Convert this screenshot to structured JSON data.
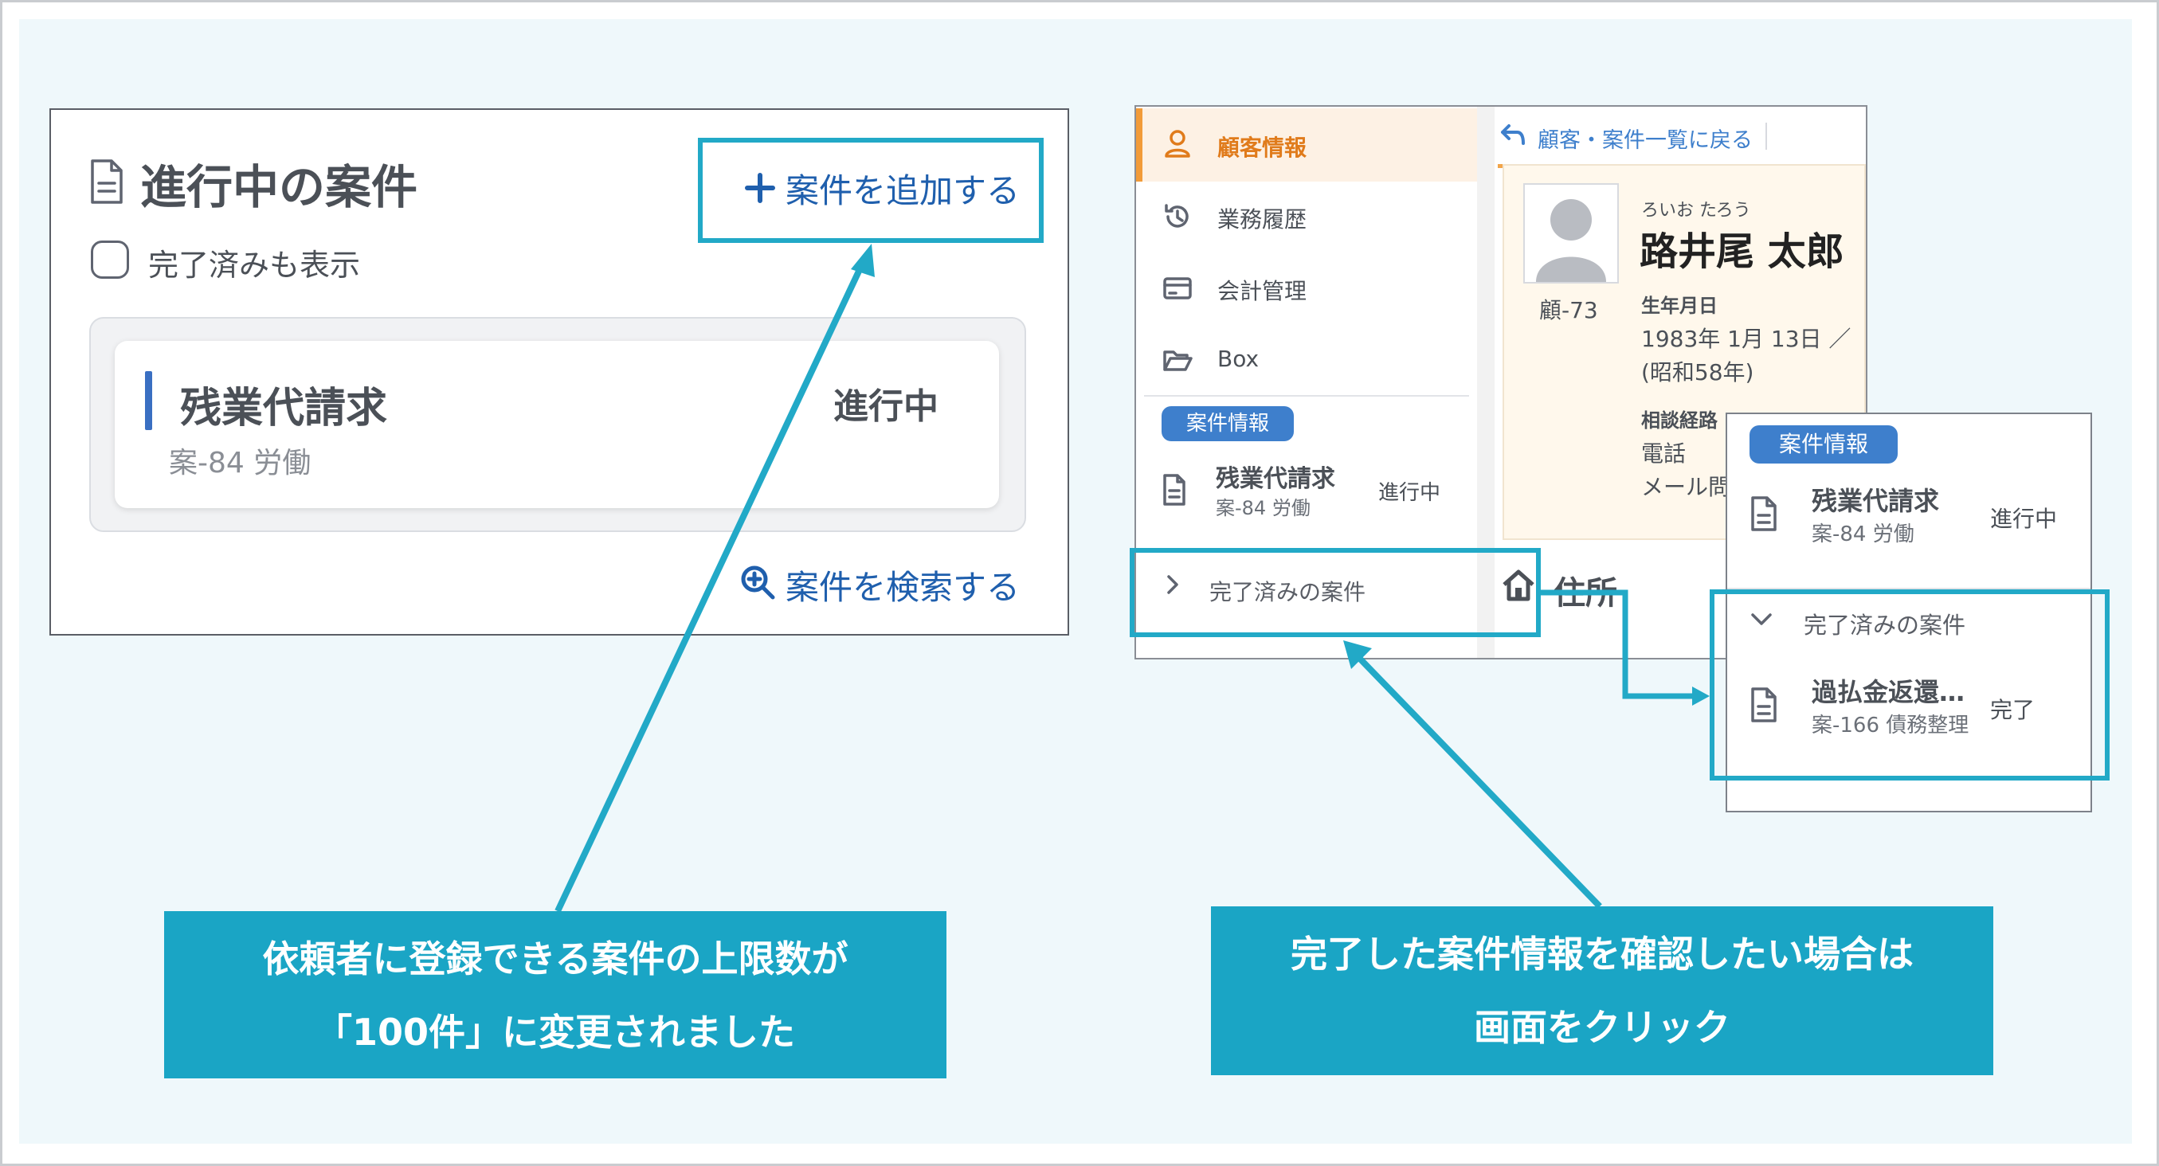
{
  "left_panel": {
    "title": "進行中の案件",
    "add_button": "案件を追加する",
    "show_completed_label": "完了済みも表示",
    "case": {
      "title": "残業代請求",
      "subtitle": "案-84 労働",
      "status": "進行中"
    },
    "search_link": "案件を検索する"
  },
  "right_panel": {
    "sidebar": {
      "items": [
        {
          "label": "顧客情報",
          "icon": "person-icon",
          "active": true
        },
        {
          "label": "業務履歴",
          "icon": "history-icon"
        },
        {
          "label": "会計管理",
          "icon": "card-icon"
        },
        {
          "label": "Box",
          "icon": "folder-icon"
        }
      ],
      "case_section_label": "案件情報",
      "case": {
        "title": "残業代請求",
        "subtitle": "案-84 労働",
        "status": "進行中"
      },
      "completed_label": "完了済みの案件"
    },
    "back_link": "顧客・案件一覧に戻る",
    "profile": {
      "customer_id": "顧-73",
      "kana": "ろいお たろう",
      "name": "路井尾 太郎",
      "birth_label": "生年月日",
      "birth_value": "1983年 1月 13日 ／",
      "era_value": "(昭和58年)",
      "route_label": "相談経路",
      "phone_label": "電話",
      "mail_label": "メール問"
    },
    "address_label": "住所"
  },
  "popup": {
    "case_section_label": "案件情報",
    "active_case": {
      "title": "残業代請求",
      "subtitle": "案-84 労働",
      "status": "進行中"
    },
    "completed_label": "完了済みの案件",
    "completed_case": {
      "title": "過払金返還…",
      "subtitle": "案-166 債務整理",
      "status": "完了"
    }
  },
  "callouts": {
    "left_line1": "依頼者に登録できる案件の上限数が",
    "left_line2": "「100件」に変更されました",
    "right_line1": "完了した案件情報を確認したい場合は",
    "right_line2": "画面をクリック"
  },
  "colors": {
    "accent": "#1aa5c5",
    "link": "#1f5fad",
    "active": "#f29b38",
    "pill": "#3e7fcc"
  }
}
